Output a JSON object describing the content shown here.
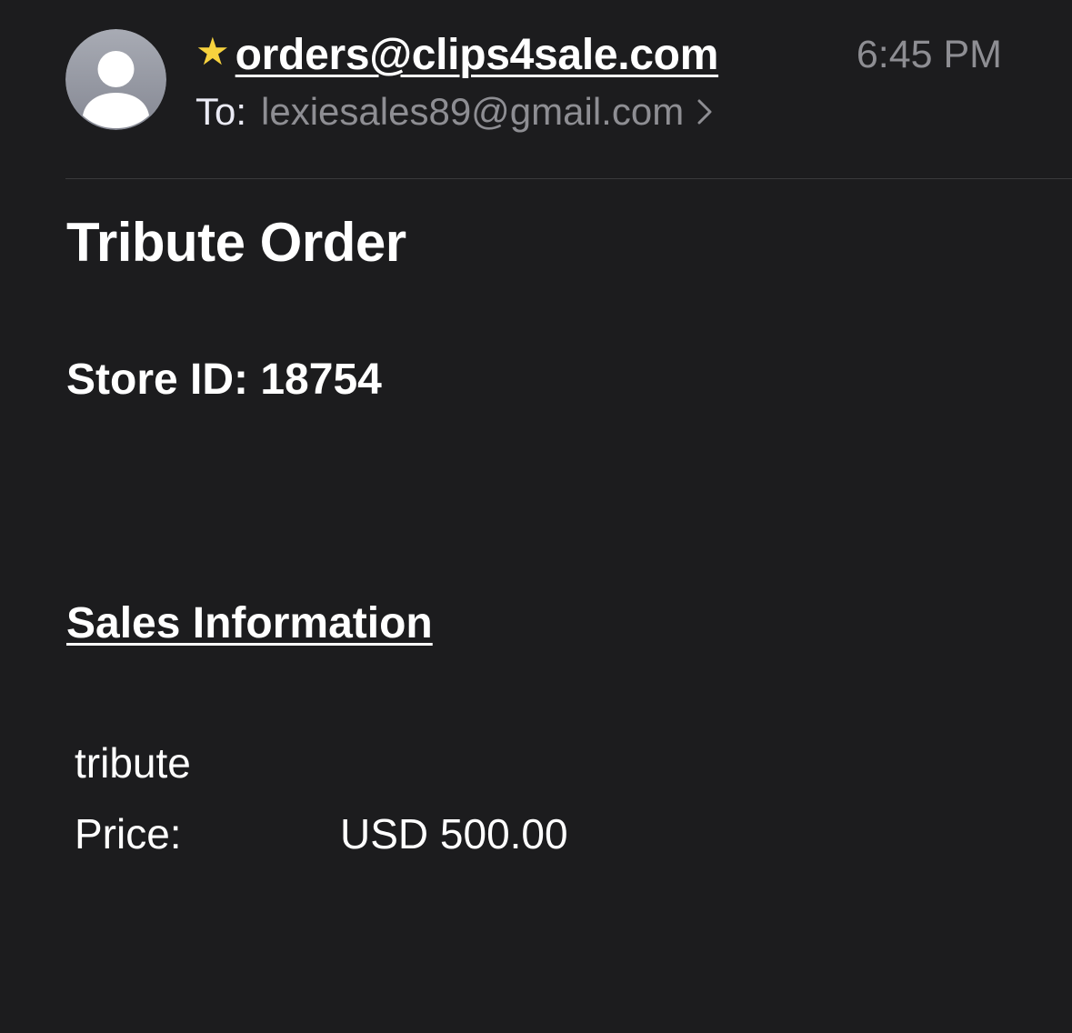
{
  "header": {
    "avatar_icon": "person-silhouette-icon",
    "star_icon": "star-icon",
    "star_glyph": "★",
    "star_color": "#f7d23e",
    "sender": "orders@clips4sale.com",
    "time": "6:45 PM",
    "to_label": "To:",
    "to_address": "lexiesales89@gmail.com",
    "chevron_icon": "chevron-right-icon"
  },
  "body": {
    "title": "Tribute Order",
    "store_id": "Store ID: 18754",
    "sales_heading": "Sales Information",
    "item_name": "tribute",
    "price_label": "Price:",
    "price_value": "USD 500.00"
  },
  "colors": {
    "background": "#1c1c1e",
    "secondary_text": "#8e8e93",
    "divider": "#3a3a3c"
  }
}
